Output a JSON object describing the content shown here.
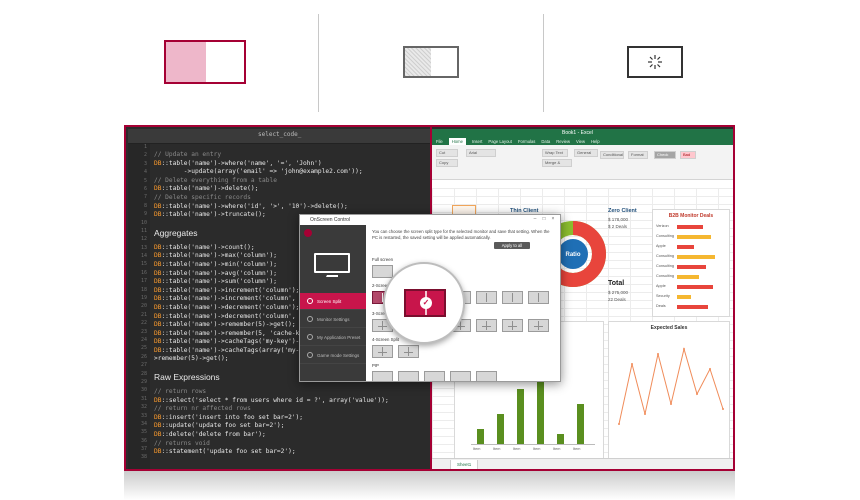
{
  "colors": {
    "accent": "#a50034",
    "accent_light": "#eeb7ca",
    "excel_green": "#217346",
    "code_bg": "#2b2b2b"
  },
  "modes": [
    {
      "name": "split-2-mode",
      "icon": "split-screen-icon",
      "selected": true
    },
    {
      "name": "pip-mode",
      "icon": "picture-in-picture-icon",
      "selected": false
    },
    {
      "name": "brightness-mode",
      "icon": "sun-icon",
      "selected": false
    }
  ],
  "code": {
    "tab_title": "select_code_",
    "blocks": [
      {
        "lines": [
          {
            "t": "// Update an entry",
            "c": "comment"
          },
          {
            "t": "DB::table('name')->where('name', '=', 'John')"
          },
          {
            "t": "        ->update(array('email' => 'john@example2.com'));"
          },
          {
            "t": "// Delete everything from a table",
            "c": "comment"
          },
          {
            "t": "DB::table('name')->delete();"
          },
          {
            "t": "// Delete specific records",
            "c": "comment"
          },
          {
            "t": "DB::table('name')->where('id', '>', '10')->delete();"
          },
          {
            "t": "DB::table('name')->truncate();"
          }
        ]
      },
      {
        "heading": "Aggregates",
        "lines": [
          {
            "t": "DB::table('name')->count();"
          },
          {
            "t": "DB::table('name')->max('column');"
          },
          {
            "t": "DB::table('name')->min('column');"
          },
          {
            "t": "DB::table('name')->avg('column');"
          },
          {
            "t": "DB::table('name')->sum('column');"
          },
          {
            "t": "DB::table('name')->increment('column');"
          },
          {
            "t": "DB::table('name')->increment('column', $amou"
          },
          {
            "t": "DB::table('name')->decrement('column');"
          },
          {
            "t": "DB::table('name')->decrement('column', $amou"
          },
          {
            "t": "DB::table('name')->remember(5)->get();"
          },
          {
            "t": "DB::table('name')->remember(5, 'cache-key-na"
          },
          {
            "t": "DB::table('name')->cacheTags('my-key')->remem"
          },
          {
            "t": "DB::table('name')->cacheTags(array('my-first"
          },
          {
            "t": ">remember(5)->get();"
          }
        ]
      },
      {
        "heading": "Raw Expressions",
        "lines": [
          {
            "t": "// return rows",
            "c": "comment"
          },
          {
            "t": "DB::select('select * from users where id = ?', array('value'));"
          },
          {
            "t": "// return nr affected rows",
            "c": "comment"
          },
          {
            "t": "DB::insert('insert into foo set bar=2');"
          },
          {
            "t": "DB::update('update foo set bar=2');"
          },
          {
            "t": "DB::delete('delete from bar');"
          },
          {
            "t": "// returns void",
            "c": "comment"
          },
          {
            "t": "DB::statement('update foo set bar=2');"
          }
        ]
      }
    ]
  },
  "excel": {
    "title": "Book1 - Excel",
    "ribbon_tabs": [
      "File",
      "Home",
      "Insert",
      "Page Layout",
      "Formulas",
      "Data",
      "Review",
      "View",
      "Help"
    ],
    "active_tab": "Home",
    "ribbon_items": [
      "Cut",
      "Copy",
      "Arial",
      "Wrap Text",
      "General",
      "Merge & Center",
      "Conditional Formatting",
      "Format as Table",
      "Check Cell",
      "Bad"
    ],
    "kpi_label": "Thin Client",
    "zero_client_label": "Zero Client",
    "ratio_label": "Ratio",
    "total_label": "Total",
    "b2b_title": "B2B Monitor Deals",
    "expected_sales_title": "Expected Sales",
    "sheet_tab": "Sheet1",
    "zero_client_value_1": "$ 178,000",
    "zero_client_value_2": "$ 2 Deals",
    "total_value_1": "$ 275,000",
    "total_value_2": "22 Deals",
    "donut": {
      "values": [
        62,
        38
      ],
      "colors": [
        "#e8453c",
        "#8bbd2f"
      ]
    },
    "b2b_rows": [
      "Verizon",
      "Consulting",
      "Apple",
      "Consulting",
      "Consulting",
      "Consulting",
      "Apple",
      "Security",
      "Deals"
    ],
    "b2b_values": [
      0.55,
      0.7,
      0.35,
      0.8,
      0.6,
      0.45,
      0.75,
      0.3,
      0.65
    ],
    "bar_values": [
      0.15,
      0.3,
      0.55,
      0.85,
      0.1,
      0.4
    ],
    "bar_categories": [
      "Item",
      "Item",
      "Item",
      "Item",
      "Item",
      "Item"
    ],
    "line_values": [
      0.2,
      0.8,
      0.3,
      0.9,
      0.4,
      0.95,
      0.5,
      0.75,
      0.35
    ]
  },
  "dialog": {
    "title": "OnScreen Control",
    "info_text": "You can choose the screen split type for the selected monitor and save that setting. When the PC is restarted, the saved setting will be applied automatically.",
    "apply_label": "Apply to all",
    "nav": [
      {
        "label": "Screen Split",
        "active": true,
        "icon": "split-screen-icon"
      },
      {
        "label": "Monitor Settings",
        "active": false,
        "icon": "settings-icon"
      },
      {
        "label": "My Application Preset",
        "active": false,
        "icon": "preset-icon"
      },
      {
        "label": "Game mode Settings",
        "active": false,
        "icon": "game-icon"
      }
    ],
    "sections": [
      "Full screen",
      "2-Screen Split",
      "3-Screen Split",
      "4-Screen Split",
      "PIP"
    ]
  }
}
